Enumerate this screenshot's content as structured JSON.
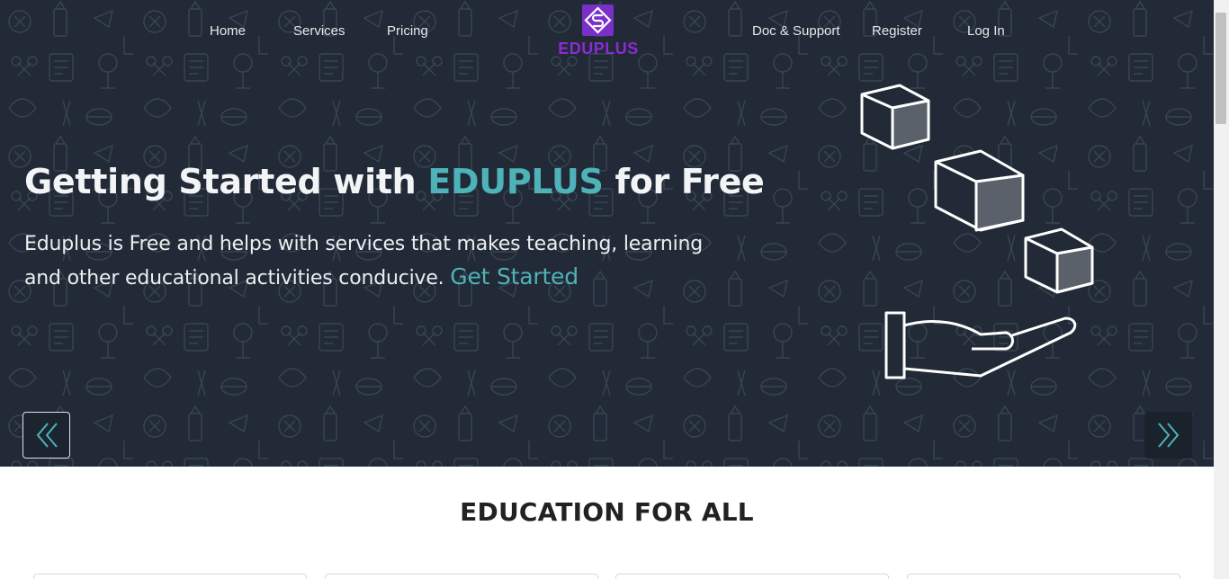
{
  "nav": {
    "left": [
      "Home",
      "Services",
      "Pricing"
    ],
    "right": [
      "Doc & Support",
      "Register",
      "Log In"
    ],
    "logo_text": "EDUPLUS"
  },
  "hero": {
    "title_prefix": "Getting Started with ",
    "title_accent": "EDUPLUS",
    "title_suffix": " for Free",
    "description": "Eduplus is Free and helps with services that makes teaching, learning and other educational activities conducive. ",
    "cta": "Get Started"
  },
  "carousel": {
    "prev_icon": "double-chevron-left-icon",
    "next_icon": "double-chevron-right-icon"
  },
  "section": {
    "title": "EDUCATION FOR ALL"
  },
  "colors": {
    "hero_bg": "#212a36",
    "accent": "#4eb3b8",
    "brand": "#8a2bd4"
  }
}
